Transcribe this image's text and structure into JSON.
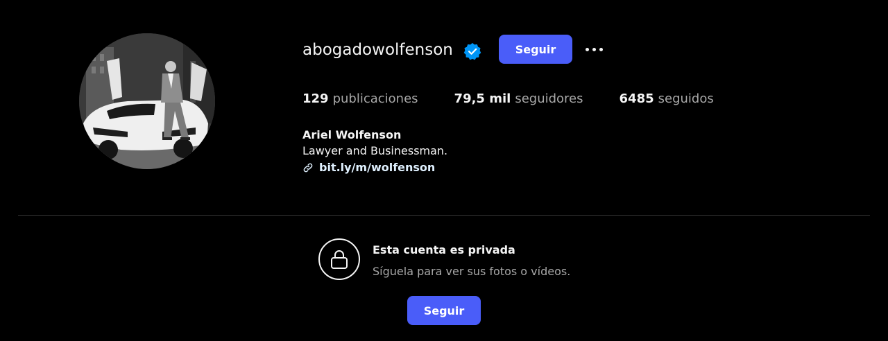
{
  "profile": {
    "username": "abogadowolfenson",
    "verified": true,
    "follow_label": "Seguir",
    "more_icon": "more-options-icon",
    "avatar_icon": "profile-photo"
  },
  "stats": {
    "posts_count": "129",
    "posts_label": "publicaciones",
    "followers_count": "79,5 mil",
    "followers_label": "seguidores",
    "following_count": "6485",
    "following_label": "seguidos"
  },
  "bio": {
    "full_name": "Ariel Wolfenson",
    "text": "Lawyer and Businessman.",
    "link_icon": "link-icon",
    "link": "bit.ly/m/wolfenson"
  },
  "private": {
    "lock_icon": "lock-icon",
    "title": "Esta cuenta es privada",
    "subtitle": "Síguela para ver sus fotos o vídeos.",
    "follow_label": "Seguir"
  },
  "colors": {
    "background": "#000000",
    "accent": "#4a5df9",
    "verified": "#0095f6",
    "secondary_text": "#a8a8a8",
    "link_text": "#e0f1ff",
    "divider": "#363636"
  }
}
